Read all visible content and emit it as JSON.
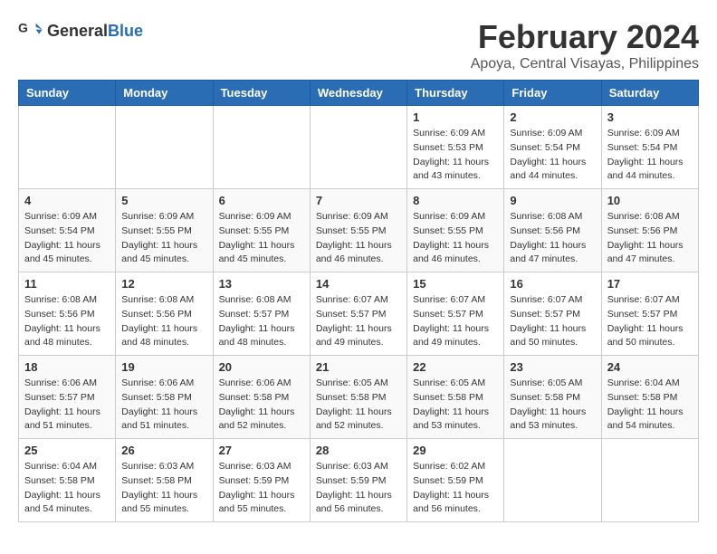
{
  "header": {
    "logo_general": "General",
    "logo_blue": "Blue",
    "month_year": "February 2024",
    "location": "Apoya, Central Visayas, Philippines"
  },
  "days_of_week": [
    "Sunday",
    "Monday",
    "Tuesday",
    "Wednesday",
    "Thursday",
    "Friday",
    "Saturday"
  ],
  "weeks": [
    [
      {
        "day": "",
        "sunrise": "",
        "sunset": "",
        "daylight": ""
      },
      {
        "day": "",
        "sunrise": "",
        "sunset": "",
        "daylight": ""
      },
      {
        "day": "",
        "sunrise": "",
        "sunset": "",
        "daylight": ""
      },
      {
        "day": "",
        "sunrise": "",
        "sunset": "",
        "daylight": ""
      },
      {
        "day": "1",
        "sunrise": "6:09 AM",
        "sunset": "5:53 PM",
        "daylight": "11 hours and 43 minutes."
      },
      {
        "day": "2",
        "sunrise": "6:09 AM",
        "sunset": "5:54 PM",
        "daylight": "11 hours and 44 minutes."
      },
      {
        "day": "3",
        "sunrise": "6:09 AM",
        "sunset": "5:54 PM",
        "daylight": "11 hours and 44 minutes."
      }
    ],
    [
      {
        "day": "4",
        "sunrise": "6:09 AM",
        "sunset": "5:54 PM",
        "daylight": "11 hours and 45 minutes."
      },
      {
        "day": "5",
        "sunrise": "6:09 AM",
        "sunset": "5:55 PM",
        "daylight": "11 hours and 45 minutes."
      },
      {
        "day": "6",
        "sunrise": "6:09 AM",
        "sunset": "5:55 PM",
        "daylight": "11 hours and 45 minutes."
      },
      {
        "day": "7",
        "sunrise": "6:09 AM",
        "sunset": "5:55 PM",
        "daylight": "11 hours and 46 minutes."
      },
      {
        "day": "8",
        "sunrise": "6:09 AM",
        "sunset": "5:55 PM",
        "daylight": "11 hours and 46 minutes."
      },
      {
        "day": "9",
        "sunrise": "6:08 AM",
        "sunset": "5:56 PM",
        "daylight": "11 hours and 47 minutes."
      },
      {
        "day": "10",
        "sunrise": "6:08 AM",
        "sunset": "5:56 PM",
        "daylight": "11 hours and 47 minutes."
      }
    ],
    [
      {
        "day": "11",
        "sunrise": "6:08 AM",
        "sunset": "5:56 PM",
        "daylight": "11 hours and 48 minutes."
      },
      {
        "day": "12",
        "sunrise": "6:08 AM",
        "sunset": "5:56 PM",
        "daylight": "11 hours and 48 minutes."
      },
      {
        "day": "13",
        "sunrise": "6:08 AM",
        "sunset": "5:57 PM",
        "daylight": "11 hours and 48 minutes."
      },
      {
        "day": "14",
        "sunrise": "6:07 AM",
        "sunset": "5:57 PM",
        "daylight": "11 hours and 49 minutes."
      },
      {
        "day": "15",
        "sunrise": "6:07 AM",
        "sunset": "5:57 PM",
        "daylight": "11 hours and 49 minutes."
      },
      {
        "day": "16",
        "sunrise": "6:07 AM",
        "sunset": "5:57 PM",
        "daylight": "11 hours and 50 minutes."
      },
      {
        "day": "17",
        "sunrise": "6:07 AM",
        "sunset": "5:57 PM",
        "daylight": "11 hours and 50 minutes."
      }
    ],
    [
      {
        "day": "18",
        "sunrise": "6:06 AM",
        "sunset": "5:57 PM",
        "daylight": "11 hours and 51 minutes."
      },
      {
        "day": "19",
        "sunrise": "6:06 AM",
        "sunset": "5:58 PM",
        "daylight": "11 hours and 51 minutes."
      },
      {
        "day": "20",
        "sunrise": "6:06 AM",
        "sunset": "5:58 PM",
        "daylight": "11 hours and 52 minutes."
      },
      {
        "day": "21",
        "sunrise": "6:05 AM",
        "sunset": "5:58 PM",
        "daylight": "11 hours and 52 minutes."
      },
      {
        "day": "22",
        "sunrise": "6:05 AM",
        "sunset": "5:58 PM",
        "daylight": "11 hours and 53 minutes."
      },
      {
        "day": "23",
        "sunrise": "6:05 AM",
        "sunset": "5:58 PM",
        "daylight": "11 hours and 53 minutes."
      },
      {
        "day": "24",
        "sunrise": "6:04 AM",
        "sunset": "5:58 PM",
        "daylight": "11 hours and 54 minutes."
      }
    ],
    [
      {
        "day": "25",
        "sunrise": "6:04 AM",
        "sunset": "5:58 PM",
        "daylight": "11 hours and 54 minutes."
      },
      {
        "day": "26",
        "sunrise": "6:03 AM",
        "sunset": "5:58 PM",
        "daylight": "11 hours and 55 minutes."
      },
      {
        "day": "27",
        "sunrise": "6:03 AM",
        "sunset": "5:59 PM",
        "daylight": "11 hours and 55 minutes."
      },
      {
        "day": "28",
        "sunrise": "6:03 AM",
        "sunset": "5:59 PM",
        "daylight": "11 hours and 56 minutes."
      },
      {
        "day": "29",
        "sunrise": "6:02 AM",
        "sunset": "5:59 PM",
        "daylight": "11 hours and 56 minutes."
      },
      {
        "day": "",
        "sunrise": "",
        "sunset": "",
        "daylight": ""
      },
      {
        "day": "",
        "sunrise": "",
        "sunset": "",
        "daylight": ""
      }
    ]
  ],
  "labels": {
    "sunrise_prefix": "Sunrise: ",
    "sunset_prefix": "Sunset: ",
    "daylight_prefix": "Daylight: "
  }
}
